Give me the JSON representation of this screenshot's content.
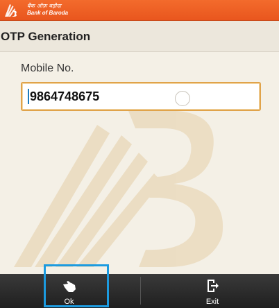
{
  "brand": {
    "hindi_name": "बैंक ऑफ़ बड़ौदा",
    "english_name": "Bank of Baroda",
    "accent_color": "#f0642a"
  },
  "screen": {
    "title": "OTP Generation"
  },
  "form": {
    "mobile_label": "Mobile No.",
    "mobile_value": "9864748675"
  },
  "bottom_bar": {
    "ok_label": "Ok",
    "ok_icon": "hand-pointer-icon",
    "exit_label": "Exit",
    "exit_icon": "exit-icon"
  }
}
